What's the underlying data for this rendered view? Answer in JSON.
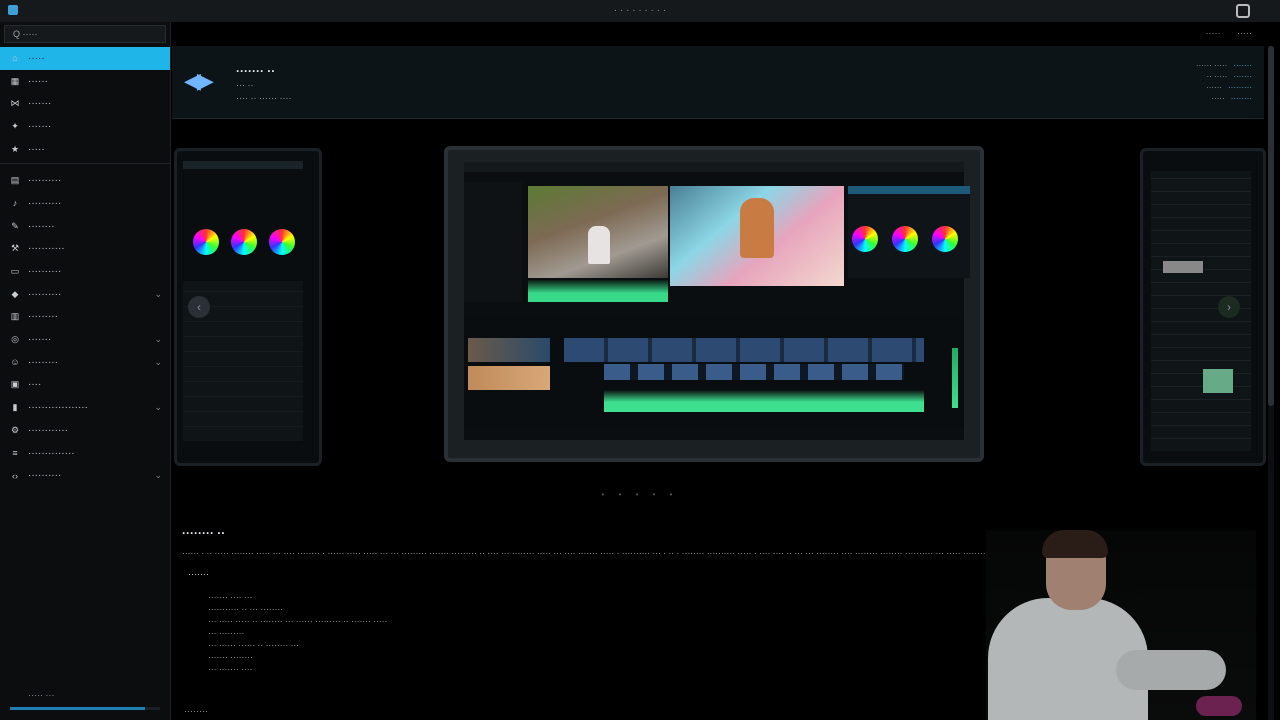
{
  "window": {
    "title": "· · · · · · · · ·"
  },
  "sidebar": {
    "search_placeholder": "Q ·····",
    "items": [
      {
        "label": "·····",
        "icon": "home-icon",
        "active": true
      },
      {
        "label": "······",
        "icon": "grid-icon"
      },
      {
        "label": "·······",
        "icon": "share-icon"
      },
      {
        "label": "·······",
        "icon": "sparkle-icon"
      },
      {
        "label": "·····",
        "icon": "star-icon"
      },
      {
        "label": "··········",
        "icon": "film-icon"
      },
      {
        "label": "··········",
        "icon": "music-icon"
      },
      {
        "label": "········",
        "icon": "pen-icon"
      },
      {
        "label": "···········",
        "icon": "wrench-icon"
      },
      {
        "label": "··········",
        "icon": "terminal-icon"
      },
      {
        "label": "··········",
        "icon": "cube-icon",
        "chevron": true
      },
      {
        "label": "·········",
        "icon": "book-icon"
      },
      {
        "label": "·······",
        "icon": "globe-icon",
        "chevron": true
      },
      {
        "label": "·········",
        "icon": "person-icon",
        "chevron": true
      },
      {
        "label": "····",
        "icon": "gamepad-icon"
      },
      {
        "label": "··················",
        "icon": "lock-icon",
        "chevron": true
      },
      {
        "label": "············",
        "icon": "gear-icon"
      },
      {
        "label": "··············",
        "icon": "database-icon"
      },
      {
        "label": "··········",
        "icon": "code-icon",
        "chevron": true
      }
    ],
    "footer": "·····  ···",
    "progress": 0.9
  },
  "topright": {
    "a": "·····",
    "b": "·····"
  },
  "app": {
    "name": "······· ··",
    "version": "··· ··",
    "developer": "···· ·· ······ ····",
    "meta": [
      {
        "k": "······ ·····",
        "v": "·······"
      },
      {
        "k": "·· ·····",
        "v": "·······"
      },
      {
        "k": "······",
        "v": "·········"
      },
      {
        "k": "·····",
        "v": "········"
      }
    ]
  },
  "description": {
    "heading": "········ ··",
    "paragraph": "······ · ·· ····· ········ ····· ··· ···· ········ · ······ ····· ····· ··· ··· ········· ······· ········· ·· ···· ··· ········ ····· ··· ···· ······· ····· · ·········· ··· · ·· · ········ ·········· ····· · ···· ···· ·· ··· ··· ········ ···· ········ ········ ·········· ··· ····· ········",
    "subheading": "·······",
    "list": [
      "······· ···· ···",
      "··········· ·· ··· ········",
      "··· ····· ····· ·· ········ ··· ······ ········· ·· ······· ·····",
      "··· ·········",
      "··· ······ ······ ·· ········ ···",
      "······· ········",
      "··· ······· ····"
    ],
    "tail": "········"
  },
  "gallery": {
    "dots": "• • • • •"
  }
}
